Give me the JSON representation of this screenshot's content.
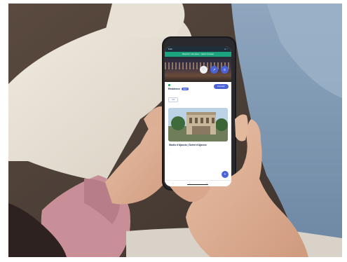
{
  "phone": {
    "status_time": "9:41",
    "status_icons": "▪▪ ◔",
    "banner_text": "Réservez votre place · Opéra Comique",
    "hero_buttons": [
      {
        "icon": "heart-icon",
        "glyph": "♡"
      },
      {
        "icon": "share-icon",
        "glyph": "↗"
      },
      {
        "icon": "menu-icon",
        "glyph": "≡"
      }
    ],
    "title": "Résidence",
    "badge": "NEW",
    "subtitle": "",
    "primary_button": "Consulter",
    "outline_button": "Voir",
    "favorite_icon": "star-icon",
    "venue": {
      "title": "Studio d'Ajaccio | Scène d'Ajaccio",
      "subtitle": "",
      "line1": "",
      "line2": ""
    },
    "fab_icon": "plus-icon",
    "nav_icons": [
      "home-icon",
      "search-icon",
      "ticket-icon",
      "user-icon"
    ]
  },
  "colors": {
    "accent": "#4a63d6",
    "banner": "#1aa57e",
    "favorite": "#f3c623"
  }
}
